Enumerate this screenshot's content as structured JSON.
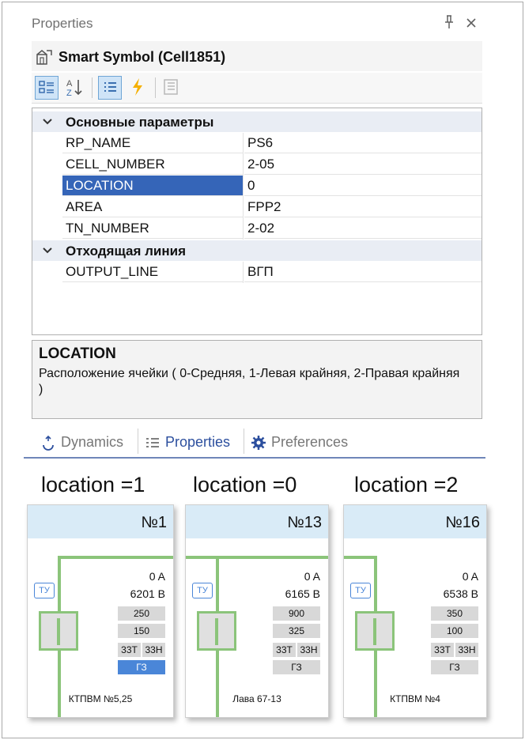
{
  "panel": {
    "title": "Properties",
    "pin_glyph": "ᵖ",
    "close_glyph": "×",
    "object_name": "Smart Symbol (Cell1851)",
    "icons": {
      "object": "smart-symbol-icon",
      "pin": "pin-icon",
      "close": "close-icon"
    }
  },
  "toolbar": {
    "buttons": [
      {
        "name": "categorized-icon",
        "active": true
      },
      {
        "name": "alphabetical-icon",
        "active": false
      },
      {
        "name": "properties-view-icon",
        "active": true
      },
      {
        "name": "events-icon",
        "active": false
      },
      {
        "name": "property-pages-icon",
        "active": false
      }
    ]
  },
  "grid": {
    "categories": [
      {
        "label": "Основные параметры",
        "rows": [
          {
            "key": "RP_NAME",
            "value": "PS6"
          },
          {
            "key": "CELL_NUMBER",
            "value": "2-05"
          },
          {
            "key": "LOCATION",
            "value": "0",
            "selected": true
          },
          {
            "key": "AREA",
            "value": "FPP2"
          },
          {
            "key": "TN_NUMBER",
            "value": "2-02"
          }
        ]
      },
      {
        "label": "Отходящая линия",
        "rows": [
          {
            "key": "OUTPUT_LINE",
            "value": "ВГП"
          }
        ]
      }
    ]
  },
  "help": {
    "title": "LOCATION",
    "description": "Расположение ячейки ( 0-Средняя, 1-Левая крайняя, 2-Правая крайняя )"
  },
  "tabs": [
    {
      "label": "Dynamics",
      "icon": "dynamics-icon",
      "active": false
    },
    {
      "label": "Properties",
      "icon": "properties-list-icon",
      "active": true
    },
    {
      "label": "Preferences",
      "icon": "gear-icon",
      "active": false
    }
  ],
  "examples": [
    {
      "caption": "location =1",
      "number": "№1",
      "current": "0 A",
      "voltage": "6201 B",
      "box1": "250",
      "box2": "150",
      "zz": [
        "33T",
        "33H"
      ],
      "gz": "ГЗ",
      "gz_highlight": true,
      "footer": "КТПВМ №5,25",
      "ty": "ТУ"
    },
    {
      "caption": "location =0",
      "number": "№13",
      "current": "0 A",
      "voltage": "6165 B",
      "box1": "900",
      "box2": "325",
      "zz": [
        "33T",
        "33H"
      ],
      "gz": "ГЗ",
      "gz_highlight": false,
      "footer": "Лава 67-13",
      "ty": "ТУ"
    },
    {
      "caption": "location =2",
      "number": "№16",
      "current": "0 A",
      "voltage": "6538 B",
      "box1": "350",
      "box2": "100",
      "zz": [
        "33T",
        "33H"
      ],
      "gz": "ГЗ",
      "gz_highlight": false,
      "footer": "КТПВМ №4",
      "ty": "ТУ"
    }
  ],
  "colors": {
    "selection": "#3565b8",
    "line_green": "#8bc47a",
    "header_blue": "#d9ebf7",
    "accent_blue": "#4a86d8"
  }
}
